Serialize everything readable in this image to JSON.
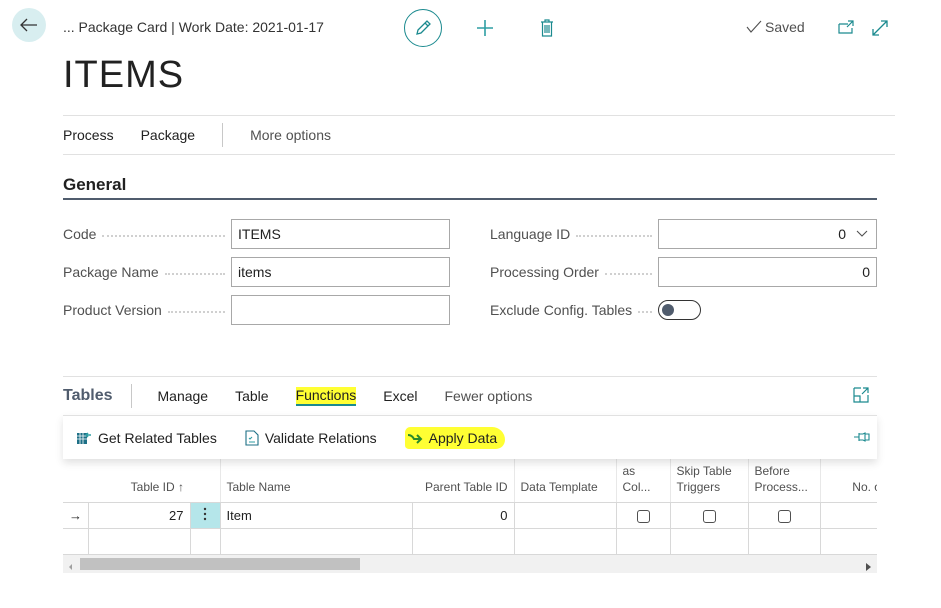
{
  "header": {
    "breadcrumb": "... Package Card | Work Date: 2021-01-17",
    "status": "Saved",
    "icons": {
      "back": "arrow-left-icon",
      "edit": "pencil-icon",
      "new": "plus-icon",
      "delete": "trash-icon",
      "saved": "checkmark-icon",
      "open_new_window": "open-in-new-window-icon",
      "expand": "expand-diagonal-icon"
    }
  },
  "page_title": "ITEMS",
  "action_bar": {
    "items": [
      "Process",
      "Package"
    ],
    "more": "More options"
  },
  "general": {
    "title": "General",
    "fields": {
      "code": {
        "label": "Code",
        "value": "ITEMS"
      },
      "package_name": {
        "label": "Package Name",
        "value": "items"
      },
      "product_version": {
        "label": "Product Version",
        "value": ""
      },
      "language_id": {
        "label": "Language ID",
        "value": "0"
      },
      "processing_order": {
        "label": "Processing Order",
        "value": "0"
      },
      "exclude_config_tables": {
        "label": "Exclude Config. Tables",
        "value": false
      }
    }
  },
  "tables_part": {
    "title": "Tables",
    "tabs": [
      "Manage",
      "Table",
      "Functions",
      "Excel"
    ],
    "active_tab": "Functions",
    "fewer": "Fewer options",
    "functions": [
      {
        "label": "Get Related Tables",
        "icon": "get-related-tables-icon"
      },
      {
        "label": "Validate Relations",
        "icon": "validate-document-icon"
      },
      {
        "label": "Apply Data",
        "icon": "green-arrow-icon"
      }
    ],
    "highlight_color": "#ffff33",
    "columns": [
      "",
      "Table ID ↑",
      "",
      "Table Name",
      "Parent Table ID",
      "Data Template",
      "as Col...",
      "Skip Table Triggers",
      "Before Process...",
      "No. of Pac Re"
    ],
    "rows": [
      {
        "indicator": "→",
        "table_id": "27",
        "table_name": "Item",
        "parent_table_id": "0",
        "data_template": "",
        "as_col": false,
        "skip_triggers": false,
        "before_process": false,
        "no_of_pac": ""
      }
    ]
  },
  "colors": {
    "accent": "#1b8a8f",
    "section_rule": "#505c6d",
    "selected_cell": "#b5e6ea"
  }
}
